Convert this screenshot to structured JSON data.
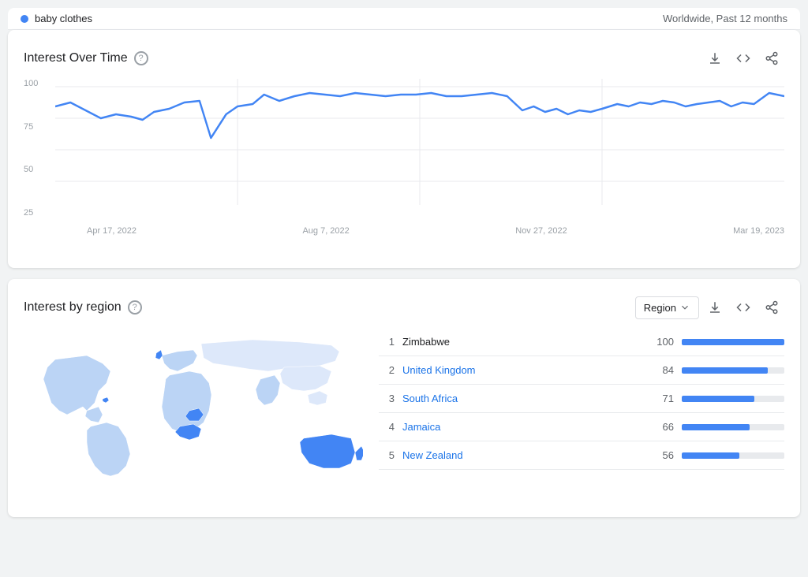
{
  "header": {
    "term": "baby clothes",
    "scope": "Worldwide, Past 12 months"
  },
  "interest_over_time": {
    "title": "Interest Over Time",
    "y_labels": [
      "100",
      "75",
      "50",
      "25"
    ],
    "x_labels": [
      "Apr 17, 2022",
      "Aug 7, 2022",
      "Nov 27, 2022",
      "Mar 19, 2023"
    ],
    "icons": {
      "download": "⬇",
      "embed": "<>",
      "share": "⚡"
    }
  },
  "interest_by_region": {
    "title": "Interest by region",
    "dropdown_label": "Region",
    "rankings": [
      {
        "rank": "1",
        "name": "Zimbabwe",
        "value": "100",
        "pct": 100,
        "linked": false
      },
      {
        "rank": "2",
        "name": "United Kingdom",
        "value": "84",
        "pct": 84,
        "linked": true
      },
      {
        "rank": "3",
        "name": "South Africa",
        "value": "71",
        "pct": 71,
        "linked": true
      },
      {
        "rank": "4",
        "name": "Jamaica",
        "value": "66",
        "pct": 66,
        "linked": true
      },
      {
        "rank": "5",
        "name": "New Zealand",
        "value": "56",
        "pct": 56,
        "linked": true
      }
    ]
  }
}
